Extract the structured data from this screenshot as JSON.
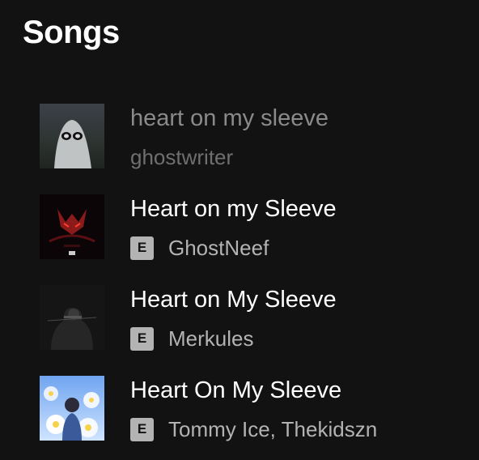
{
  "section": {
    "title": "Songs"
  },
  "tracks": [
    {
      "title": "heart on my sleeve",
      "artist": "ghostwriter",
      "explicit": false,
      "playable": false,
      "cover": "ghost-sheet-art"
    },
    {
      "title": "Heart on my Sleeve",
      "artist": "GhostNeef",
      "explicit": true,
      "explicit_label": "E",
      "playable": true,
      "cover": "red-dark-art"
    },
    {
      "title": "Heart on My Sleeve",
      "artist": "Merkules",
      "explicit": true,
      "explicit_label": "E",
      "playable": true,
      "cover": "dark-figure-art"
    },
    {
      "title": "Heart On My Sleeve",
      "artist": "Tommy Ice, Thekidszn",
      "explicit": true,
      "explicit_label": "E",
      "playable": true,
      "cover": "blue-flowers-art"
    }
  ],
  "colors": {
    "background": "#121212",
    "text_primary": "#ffffff",
    "text_secondary": "#b3b3b3",
    "text_disabled": "#8a8a8a",
    "explicit_badge": "#b3b3b3"
  }
}
